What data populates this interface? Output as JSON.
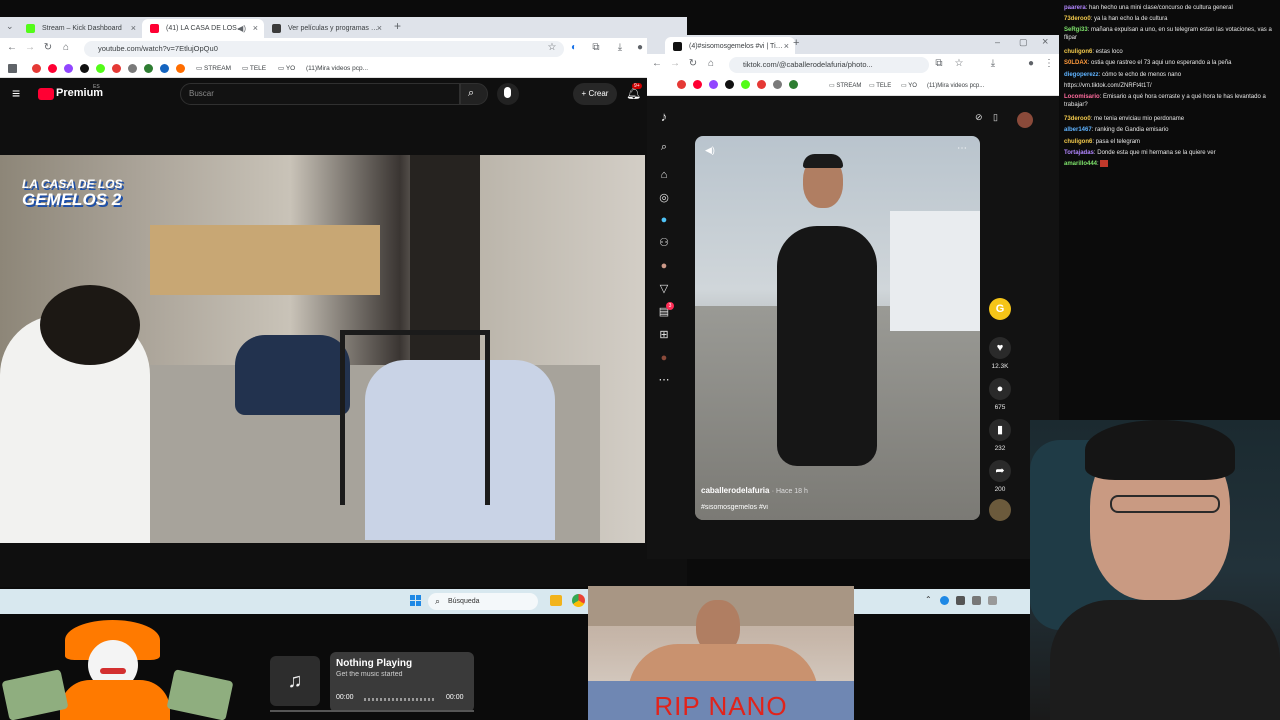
{
  "youtube_browser": {
    "tabs": [
      {
        "label": "Stream – Kick Dashboard",
        "color": "#53fc18"
      },
      {
        "label": "(41) LA CASA DE LOS GEM",
        "color": "#ff0033"
      },
      {
        "label": "Ver películas y programas de te",
        "color": "#e5a00d"
      }
    ],
    "new_tab": "+",
    "url": "youtube.com/watch?v=7EtlujOpQu0",
    "bookmarks": [
      "STREAM",
      "TELE",
      "YO",
      "(11)Mira videos pcp..."
    ],
    "logo_label": "Premium",
    "logo_badge": "ES",
    "search_placeholder": "Buscar",
    "create_label": "Crear",
    "notification_count": "9+",
    "video_overlay_title_line1": "LA CASA DE LOS",
    "video_overlay_title_line2": "GEMELOS 2"
  },
  "tiktok_browser": {
    "tab_label": "(4)#sisomosgemelos #vi | TikTok",
    "url": "tiktok.com/@caballerodelafuria/photo...",
    "bookmarks": [
      "STREAM",
      "TELE",
      "YO",
      "(11)Mira videos pcp..."
    ],
    "author": "caballerodelafuria",
    "posted": "· Hace 18 h",
    "caption": "#sisomosgemelos #vi",
    "likes": "12.3K",
    "comments": "675",
    "saves": "232",
    "shares": "200",
    "inbox_badge": "3"
  },
  "chat": {
    "messages": [
      {
        "user": "paarera",
        "color": "#b286ff",
        "text": ": han hecho una mini clase/concurso de cultura general"
      },
      {
        "user": "73deroo0",
        "color": "#f2c94c",
        "text": ": ya la han echo la de cultura"
      },
      {
        "user": "SeRgi33",
        "color": "#7ee36b",
        "text": ": mañana expulsan a uno, en su telegram estan las votaciones, vas a flipar"
      },
      {
        "user": "chuligon6",
        "color": "#f2c94c",
        "text": ": estas loco"
      },
      {
        "user": "S0LDAX",
        "color": "#ff9a3c",
        "text": ": ostia que rastreo el 73 aqui uno esperando a la peña"
      },
      {
        "user": "diegoperezz",
        "color": "#5fb3ff",
        "text": ": cómo te echo de menos nano"
      },
      {
        "user": "",
        "color": "#e8e8e8",
        "text": "https://vm.tiktok.com/ZNRFt4t1T/"
      },
      {
        "user": "Locomisario",
        "color": "#ff6b9d",
        "text": ": Emisario a qué hora cerraste y a qué hora te has levantado a trabajar?"
      },
      {
        "user": "73deroo0",
        "color": "#f2c94c",
        "text": ": me tenia enviciau mio perdoname"
      },
      {
        "user": "alber1467",
        "color": "#5fb3ff",
        "text": ": ranking de Gandia emisario"
      },
      {
        "user": "chuligon6",
        "color": "#f2c94c",
        "text": ": pasa el telegram"
      },
      {
        "user": "Tortajadas",
        "color": "#b286ff",
        "text": ": Donde esta que mi hermana se la quiere ver"
      },
      {
        "user": "amarillo444",
        "color": "#7ee36b",
        "text": ":"
      }
    ]
  },
  "taskbar": {
    "search_placeholder": "Búsqueda"
  },
  "music_widget": {
    "title": "Nothing Playing",
    "subtitle": "Get the music started",
    "time_start": "00:00",
    "time_end": "00:00",
    "progress": 0
  },
  "rip_overlay": {
    "text": "RIP NANO"
  }
}
